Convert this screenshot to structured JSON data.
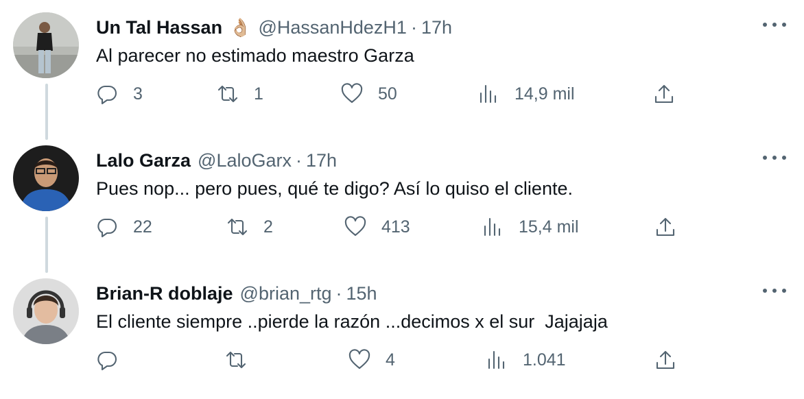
{
  "tweets": [
    {
      "name": "Un Tal Hassan",
      "badge_emoji": "👌🏼",
      "handle": "@HassanHdezH1",
      "separator": "·",
      "time": "17h",
      "text": "Al parecer no estimado maestro Garza",
      "replies": "3",
      "retweets": "1",
      "likes": "50",
      "views": "14,9 mil"
    },
    {
      "name": "Lalo Garza",
      "handle": "@LaloGarx",
      "separator": "·",
      "time": "17h",
      "text": "Pues nop... pero pues, qué te digo? Así lo quiso el cliente.",
      "replies": "22",
      "retweets": "2",
      "likes": "413",
      "views": "15,4 mil"
    },
    {
      "name": "Brian-R doblaje",
      "handle": "@brian_rtg",
      "separator": "·",
      "time": "15h",
      "text": "El cliente siempre ..pierde la razón ...decimos x el sur  Jajajaja",
      "replies": "",
      "retweets": "",
      "likes": "4",
      "views": "1.041"
    }
  ],
  "icons": {
    "reply": "reply-icon",
    "retweet": "retweet-icon",
    "like": "heart-icon",
    "views": "views-icon",
    "share": "share-icon",
    "more": "more-icon"
  },
  "colors": {
    "text": "#0f1419",
    "secondary": "#536471",
    "thread_line": "#cfd9de"
  }
}
